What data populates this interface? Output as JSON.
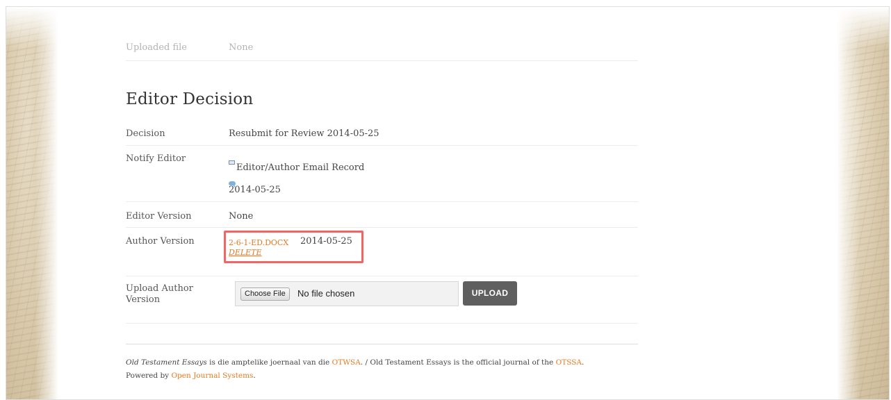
{
  "uploaded_file": {
    "label": "Uploaded file",
    "value": "None"
  },
  "section_title": "Editor Decision",
  "decision": {
    "label": "Decision",
    "value": "Resubmit for Review 2014-05-25"
  },
  "notify_editor": {
    "label": "Notify Editor",
    "email_record": "Editor/Author Email Record",
    "date": "2014-05-25",
    "icons": [
      "mail-icon",
      "comment-icon"
    ]
  },
  "editor_version": {
    "label": "Editor Version",
    "value": "None"
  },
  "author_version": {
    "label": "Author Version",
    "file_link": "2-6-1-ED.DOCX",
    "date": "2014-05-25",
    "delete_label": "DELETE"
  },
  "upload_author_version": {
    "label_line1": "Upload Author",
    "label_line2": "Version",
    "choose_file": "Choose File",
    "no_file": "No file chosen",
    "upload_button": "UPLOAD"
  },
  "footer": {
    "journal_name": "Old Testament Essays",
    "text1": " is die amptelike joernaal van die ",
    "otwsa": "OTWSA",
    "text2": ". / Old Testament Essays is the official journal of the ",
    "otssa": "OTSSA",
    "text3": ".",
    "powered_by": "Powered by ",
    "ojs": "Open Journal Systems",
    "text4": "."
  },
  "colors": {
    "link": "#e8791f",
    "highlight": "#ee6666",
    "upload_button": "#5f5f5f"
  }
}
